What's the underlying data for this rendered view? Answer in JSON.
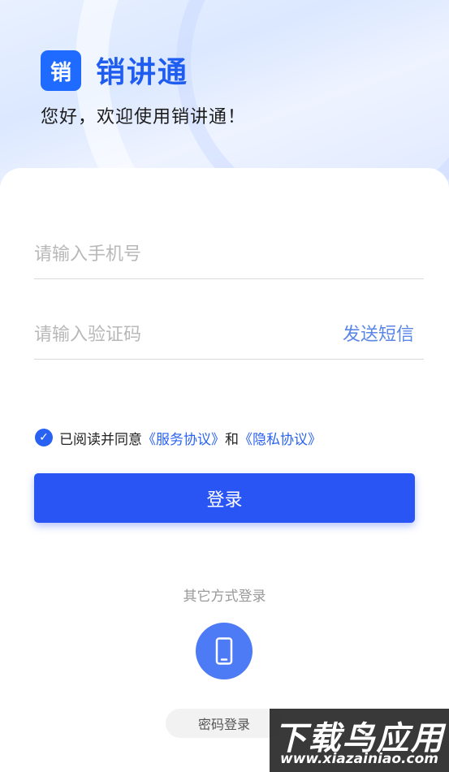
{
  "header": {
    "logo_text": "销",
    "app_name": "销讲通",
    "welcome": "您好，欢迎使用销讲通！"
  },
  "form": {
    "phone_placeholder": "请输入手机号",
    "phone_value": "",
    "code_placeholder": "请输入验证码",
    "code_value": "",
    "send_sms": "发送短信"
  },
  "agreement": {
    "checked": true,
    "prefix": "已阅读并同意",
    "service_link": "《服务协议》",
    "and": "和",
    "privacy_link": "《隐私协议》"
  },
  "login_button": "登录",
  "other_login": {
    "title": "其它方式登录",
    "phone_icon": "mobile-phone-icon",
    "password_login": "密码登录"
  },
  "watermark": {
    "main": "下载鸟应用",
    "url": "www.xiazainiao.com"
  },
  "colors": {
    "brand": "#1f5cf0",
    "button": "#2a55f5",
    "link": "#2962f2"
  }
}
